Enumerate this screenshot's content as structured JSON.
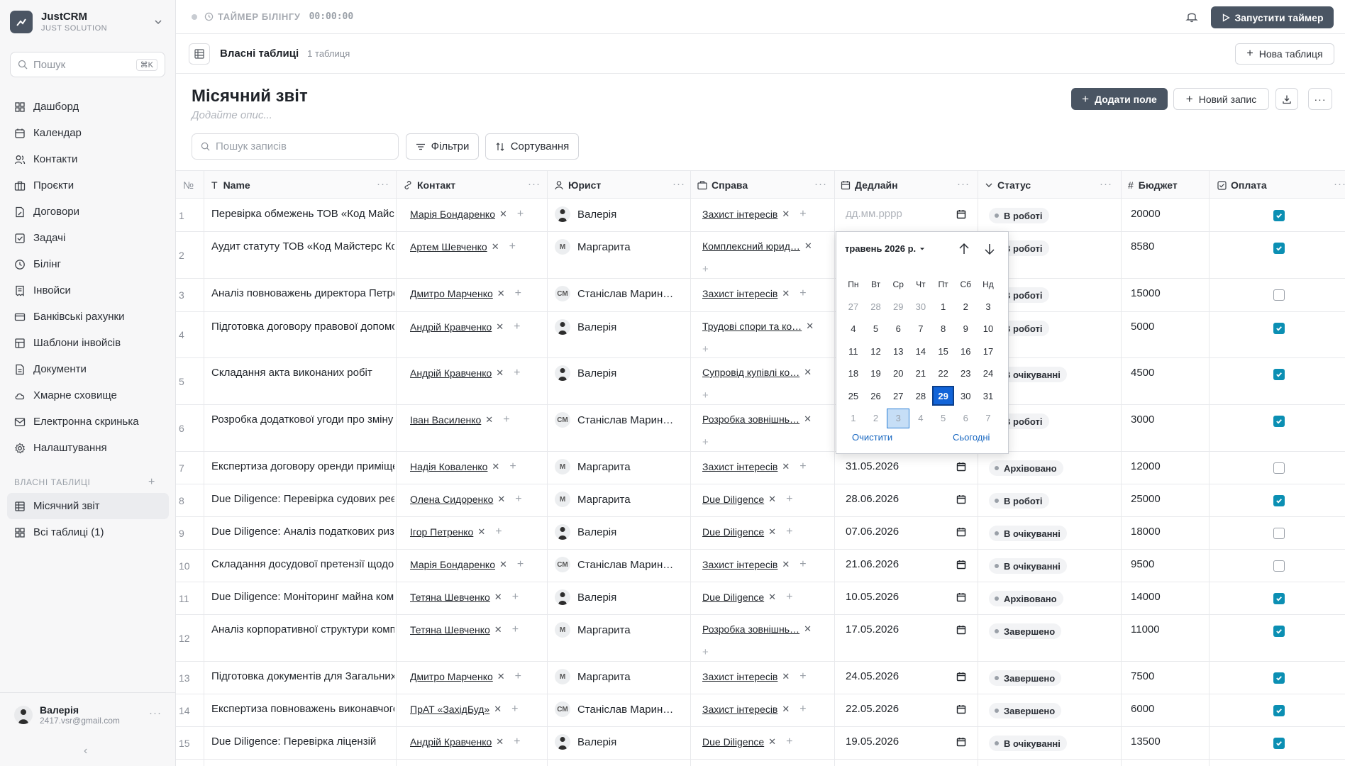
{
  "brand": {
    "name": "JustCRM",
    "sub": "JUST SOLUTION"
  },
  "search": {
    "placeholder": "Пошук",
    "shortcut": "⌘K"
  },
  "nav": [
    {
      "label": "Дашборд",
      "icon": "dashboard-icon"
    },
    {
      "label": "Календар",
      "icon": "calendar-icon"
    },
    {
      "label": "Контакти",
      "icon": "contacts-icon"
    },
    {
      "label": "Проєкти",
      "icon": "briefcase-icon"
    },
    {
      "label": "Договори",
      "icon": "document-icon"
    },
    {
      "label": "Задачі",
      "icon": "tasks-icon"
    },
    {
      "label": "Білінг",
      "icon": "clock-icon"
    },
    {
      "label": "Інвойси",
      "icon": "invoice-icon"
    },
    {
      "label": "Банківські рахунки",
      "icon": "bank-card-icon"
    },
    {
      "label": "Шаблони інвойсів",
      "icon": "template-icon"
    },
    {
      "label": "Документи",
      "icon": "file-icon"
    },
    {
      "label": "Хмарне сховище",
      "icon": "cloud-icon"
    },
    {
      "label": "Електронна скринька",
      "icon": "mail-icon"
    },
    {
      "label": "Налаштування",
      "icon": "gear-icon"
    }
  ],
  "custom_tables": {
    "label": "ВЛАСНІ ТАБЛИЦІ",
    "items": [
      {
        "label": "Місячний звіт",
        "active": true
      },
      {
        "label": "Всі таблиці (1)",
        "active": false
      }
    ]
  },
  "user": {
    "name": "Валерія",
    "email": "2417.vsr@gmail.com"
  },
  "topbar": {
    "timer_label": "ТАЙМЕР БІЛІНГУ",
    "timer_value": "00:00:00",
    "start_button": "Запустити таймер"
  },
  "header": {
    "title": "Власні таблиці",
    "count": "1 таблиця",
    "new_table": "Нова таблиця"
  },
  "page": {
    "title": "Місячний звіт",
    "description_placeholder": "Додайте опис...",
    "add_field": "Додати поле",
    "new_record": "Новий запис",
    "search_placeholder": "Пошук записів",
    "filters": "Фільтри",
    "sort": "Сортування"
  },
  "columns": {
    "num": "№",
    "name": "Name",
    "contact": "Контакт",
    "lawyer": "Юрист",
    "case": "Справа",
    "deadline": "Дедлайн",
    "status": "Статус",
    "budget": "Бюджет",
    "paid": "Оплата"
  },
  "date_placeholder": "дд.мм.рррр",
  "rows": [
    {
      "n": "1",
      "name": "Перевірка обмежень ТОВ «Код Майстерс Консалтинг»",
      "contact": "Марія Бондаренко",
      "lawyer": "Валерія",
      "case": "Захист інтересів",
      "deadline": "",
      "status": "В роботі",
      "budget": "20000",
      "paid": true
    },
    {
      "n": "2",
      "name": "Аудит статуту ТОВ «Код Майстерс Консалтинг»",
      "contact": "Артем Шевченко",
      "lawyer": "Маргарита",
      "case": "Комплексний юрид…",
      "deadline": "",
      "status": "В роботі",
      "budget": "8580",
      "paid": true
    },
    {
      "n": "3",
      "name": "Аналіз повноважень директора Петренко",
      "contact": "Дмитро Марченко",
      "lawyer": "Станіслав Марин…",
      "case": "Захист інтересів",
      "deadline": "",
      "status": "В роботі",
      "budget": "15000",
      "paid": false
    },
    {
      "n": "4",
      "name": "Підготовка договору правової допомоги",
      "contact": "Андрій Кравченко",
      "lawyer": "Валерія",
      "case": "Трудові спори та ко…",
      "deadline": "",
      "status": "В роботі",
      "budget": "5000",
      "paid": true
    },
    {
      "n": "5",
      "name": "Складання акта виконаних робіт",
      "contact": "Андрій Кравченко",
      "lawyer": "Валерія",
      "case": "Супровід купівлі ко…",
      "deadline": "",
      "status": "В очікуванні",
      "budget": "4500",
      "paid": true
    },
    {
      "n": "6",
      "name": "Розробка додаткової угоди про зміну умов",
      "contact": "Іван Василенко",
      "lawyer": "Станіслав Марин…",
      "case": "Розробка зовнішнь…",
      "deadline": "",
      "status": "В роботі",
      "budget": "3000",
      "paid": true
    },
    {
      "n": "7",
      "name": "Експертиза договору оренди приміщення",
      "contact": "Надія Коваленко",
      "lawyer": "Маргарита",
      "case": "Захист інтересів",
      "deadline": "31.05.2026",
      "status": "Архівовано",
      "budget": "12000",
      "paid": false
    },
    {
      "n": "8",
      "name": "Due Diligence: Перевірка судових реєстрів",
      "contact": "Олена Сидоренко",
      "lawyer": "Маргарита",
      "case": "Due Diligence",
      "deadline": "28.06.2026",
      "status": "В роботі",
      "budget": "25000",
      "paid": true
    },
    {
      "n": "9",
      "name": "Due Diligence: Аналіз податкових ризиків",
      "contact": "Ігор Петренко",
      "lawyer": "Валерія",
      "case": "Due Diligence",
      "deadline": "07.06.2026",
      "status": "В очікуванні",
      "budget": "18000",
      "paid": false
    },
    {
      "n": "10",
      "name": "Складання досудової претензії щодо боргу",
      "contact": "Марія Бондаренко",
      "lawyer": "Станіслав Марин…",
      "case": "Захист інтересів",
      "deadline": "21.06.2026",
      "status": "В очікуванні",
      "budget": "9500",
      "paid": false
    },
    {
      "n": "11",
      "name": "Due Diligence: Моніторинг майна компанії",
      "contact": "Тетяна Шевченко",
      "lawyer": "Валерія",
      "case": "Due Diligence",
      "deadline": "10.05.2026",
      "status": "Архівовано",
      "budget": "14000",
      "paid": true
    },
    {
      "n": "12",
      "name": "Аналіз корпоративної структури компанії",
      "contact": "Тетяна Шевченко",
      "lawyer": "Маргарита",
      "case": "Розробка зовнішнь…",
      "deadline": "17.05.2026",
      "status": "Завершено",
      "budget": "11000",
      "paid": true
    },
    {
      "n": "13",
      "name": "Підготовка документів для Загальних зборів",
      "contact": "Дмитро Марченко",
      "lawyer": "Маргарита",
      "case": "Захист інтересів",
      "deadline": "24.05.2026",
      "status": "Завершено",
      "budget": "7500",
      "paid": true
    },
    {
      "n": "14",
      "name": "Експертиза повноважень виконавчого органу",
      "contact": "ПрАТ «ЗахідБуд»",
      "lawyer": "Станіслав Марин…",
      "case": "Захист інтересів",
      "deadline": "22.05.2026",
      "status": "Завершено",
      "budget": "6000",
      "paid": true
    },
    {
      "n": "15",
      "name": "Due Diligence: Перевірка ліцензій",
      "contact": "Андрій Кравченко",
      "lawyer": "Валерія",
      "case": "Due Diligence",
      "deadline": "19.05.2026",
      "status": "В очікуванні",
      "budget": "13500",
      "paid": true
    }
  ],
  "datepicker": {
    "month_label": "травень 2026 р.",
    "weekdays": [
      "Пн",
      "Вт",
      "Ср",
      "Чт",
      "Пт",
      "Сб",
      "Нд"
    ],
    "weeks": [
      [
        "27",
        "28",
        "29",
        "30",
        "1",
        "2",
        "3"
      ],
      [
        "4",
        "5",
        "6",
        "7",
        "8",
        "9",
        "10"
      ],
      [
        "11",
        "12",
        "13",
        "14",
        "15",
        "16",
        "17"
      ],
      [
        "18",
        "19",
        "20",
        "21",
        "22",
        "23",
        "24"
      ],
      [
        "25",
        "26",
        "27",
        "28",
        "29",
        "30",
        "31"
      ],
      [
        "1",
        "2",
        "3",
        "4",
        "5",
        "6",
        "7"
      ]
    ],
    "selected_day": "29",
    "today_day": "3",
    "clear": "Очистити",
    "today": "Сьогодні"
  },
  "colors": {
    "accent_dark": "#4a5563",
    "checkbox": "#0b8fb3",
    "selected_day": "#1264d8"
  }
}
